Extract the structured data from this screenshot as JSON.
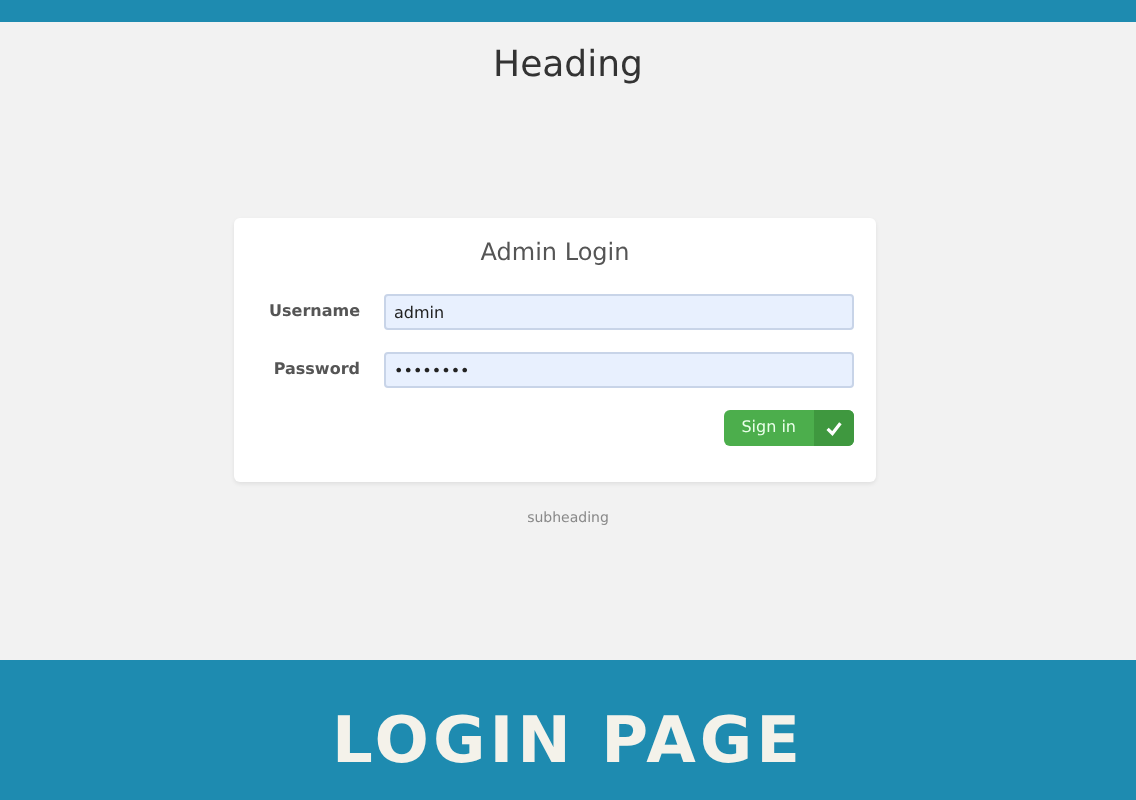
{
  "heading": "Heading",
  "login_card": {
    "title": "Admin Login",
    "fields": [
      {
        "label": "Username",
        "value": "admin"
      },
      {
        "label": "Password",
        "value": "••••••••"
      }
    ],
    "submit_button": {
      "label": "Sign in"
    }
  },
  "subheading": "subheading",
  "banner": {
    "title": "LOGIN PAGE"
  }
}
